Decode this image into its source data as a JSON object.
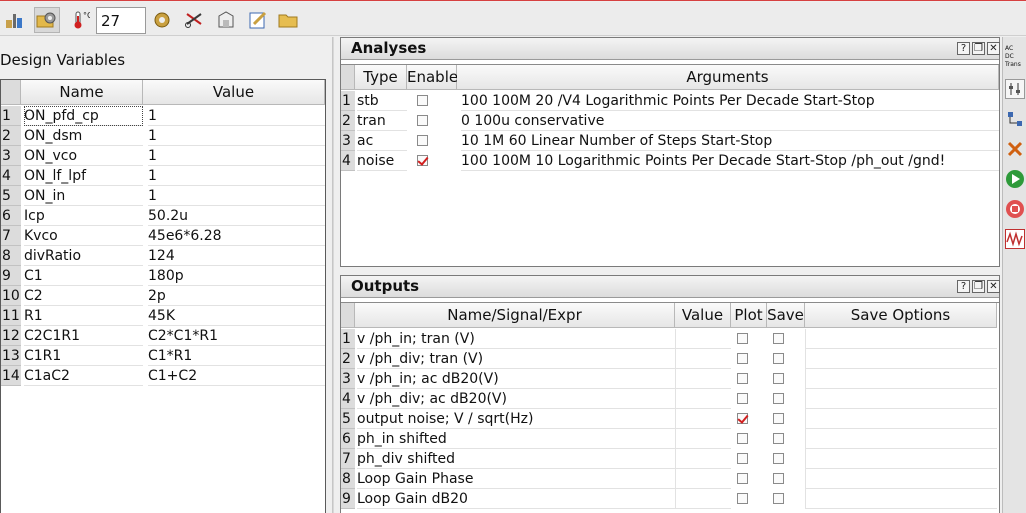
{
  "toolbar": {
    "temperature_value": "27",
    "icons": [
      "setup-icon",
      "folder-gear-icon",
      "temperature-icon",
      "gear-icon",
      "scissors-icon",
      "save-state-icon",
      "edit-icon",
      "open-folder-icon"
    ]
  },
  "design_variables": {
    "title": "Design Variables",
    "columns": [
      "Name",
      "Value"
    ],
    "rows": [
      {
        "n": "1",
        "name": "ON_pfd_cp",
        "value": "1"
      },
      {
        "n": "2",
        "name": "ON_dsm",
        "value": "1"
      },
      {
        "n": "3",
        "name": "ON_vco",
        "value": "1"
      },
      {
        "n": "4",
        "name": "ON_lf_lpf",
        "value": "1"
      },
      {
        "n": "5",
        "name": "ON_in",
        "value": "1"
      },
      {
        "n": "6",
        "name": "Icp",
        "value": "50.2u"
      },
      {
        "n": "7",
        "name": "Kvco",
        "value": "45e6*6.28"
      },
      {
        "n": "8",
        "name": "divRatio",
        "value": "124"
      },
      {
        "n": "9",
        "name": "C1",
        "value": "180p"
      },
      {
        "n": "10",
        "name": "C2",
        "value": "2p"
      },
      {
        "n": "11",
        "name": "R1",
        "value": "45K"
      },
      {
        "n": "12",
        "name": "C2C1R1",
        "value": "C2*C1*R1"
      },
      {
        "n": "13",
        "name": "C1R1",
        "value": "C1*R1"
      },
      {
        "n": "14",
        "name": "C1aC2",
        "value": "C1+C2"
      }
    ]
  },
  "analyses": {
    "title": "Analyses",
    "buttons": [
      "?",
      "❐",
      "✕"
    ],
    "columns": [
      "Type",
      "Enable",
      "Arguments"
    ],
    "rows": [
      {
        "n": "1",
        "type": "stb",
        "enabled": false,
        "args": "100 100M 20 /V4 Logarithmic Points Per Decade Start-Stop"
      },
      {
        "n": "2",
        "type": "tran",
        "enabled": false,
        "args": "0 100u conservative"
      },
      {
        "n": "3",
        "type": "ac",
        "enabled": false,
        "args": "10 1M 60 Linear Number of Steps Start-Stop"
      },
      {
        "n": "4",
        "type": "noise",
        "enabled": true,
        "args": "100 100M 10 Logarithmic Points Per Decade Start-Stop /ph_out /gnd!"
      }
    ]
  },
  "outputs": {
    "title": "Outputs",
    "buttons": [
      "?",
      "❐",
      "✕"
    ],
    "columns": [
      "Name/Signal/Expr",
      "Value",
      "Plot",
      "Save",
      "Save Options"
    ],
    "rows": [
      {
        "n": "1",
        "name": "v /ph_in; tran (V)",
        "plot": false,
        "save": false
      },
      {
        "n": "2",
        "name": "v /ph_div; tran (V)",
        "plot": false,
        "save": false
      },
      {
        "n": "3",
        "name": "v /ph_in; ac dB20(V)",
        "plot": false,
        "save": false
      },
      {
        "n": "4",
        "name": "v /ph_div; ac dB20(V)",
        "plot": false,
        "save": false
      },
      {
        "n": "5",
        "name": "output noise; V / sqrt(Hz)",
        "plot": true,
        "save": false
      },
      {
        "n": "6",
        "name": "ph_in shifted",
        "plot": false,
        "save": false
      },
      {
        "n": "7",
        "name": "ph_div shifted",
        "plot": false,
        "save": false
      },
      {
        "n": "8",
        "name": "Loop Gain Phase",
        "plot": false,
        "save": false
      },
      {
        "n": "9",
        "name": "Loop Gain dB20",
        "plot": false,
        "save": false
      }
    ]
  },
  "side_strip": {
    "analysis_options": [
      "AC",
      "DC",
      "Trans"
    ],
    "icons": [
      "analysis-select-icon",
      "tuning-icon",
      "netlist-icon",
      "delete-icon",
      "run-icon",
      "stop-icon",
      "waveform-icon"
    ]
  },
  "colors": {
    "check_mark": "#d21f1f",
    "title_bar_accent": "#d64040"
  }
}
